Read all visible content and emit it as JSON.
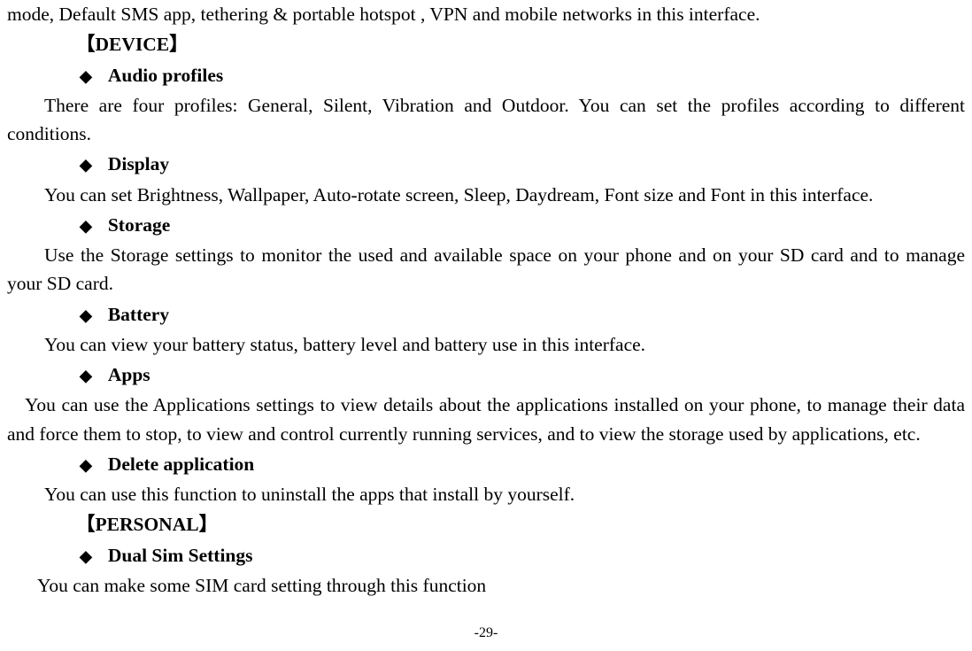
{
  "intro_continued": "mode, Default SMS app, tethering & portable hotspot , VPN and mobile networks in this interface.",
  "section_device": "【DEVICE】",
  "items": {
    "audio": {
      "title": "Audio profiles",
      "body": "There are four profiles: General, Silent, Vibration and Outdoor. You can set the profiles according to different conditions."
    },
    "display": {
      "title": "Display",
      "body": "You can set Brightness, Wallpaper, Auto-rotate screen, Sleep, Daydream, Font size and Font in this interface."
    },
    "storage": {
      "title": "Storage",
      "body": "Use the Storage settings to monitor the used and available space on your phone and on your SD card and to manage your SD card."
    },
    "battery": {
      "title": "Battery",
      "body": "You can view your battery status, battery level and battery use in this interface."
    },
    "apps": {
      "title": "Apps",
      "body": "You can use the Applications settings to view details about the applications installed on your phone, to manage their data and force them to stop, to view and control currently running services, and to view the storage used by applications, etc."
    },
    "delete": {
      "title": "Delete application",
      "body": "You can use this function to uninstall the apps that install by yourself."
    }
  },
  "section_personal": "【PERSONAL】",
  "personal_items": {
    "dual_sim": {
      "title": "Dual Sim Settings",
      "body": "You can make some SIM card setting through this function"
    }
  },
  "diamond_glyph": "◆",
  "page_number": "-29-"
}
